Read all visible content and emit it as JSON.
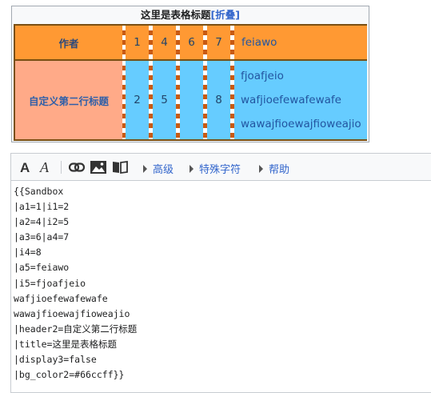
{
  "navbox": {
    "title": "这里是表格标题",
    "toggle_open": "[",
    "toggle_label": "折叠",
    "toggle_close": "]",
    "rows": [
      {
        "header": "作者",
        "cells": [
          "1",
          "4",
          "6",
          "7"
        ],
        "items": [
          "feiawo"
        ]
      },
      {
        "header": "自定义第二行标题",
        "cells": [
          "2",
          "5",
          "",
          "8"
        ],
        "items": [
          "fjoafjeio",
          "wafjioefewafewafe",
          "wawajfioewajfioweajio"
        ]
      }
    ],
    "bg_color2": "#66ccff"
  },
  "toolbar": {
    "bold_icon": "bold-A-icon",
    "italic_icon": "italic-A-icon",
    "link_icon": "link-icon",
    "image_icon": "image-icon",
    "reference_icon": "book-icon",
    "advanced": "高级",
    "special_chars": "特殊字符",
    "help": "帮助"
  },
  "editor": {
    "lines": [
      "{{Sandbox",
      "|a1=1|i1=2",
      "|a2=4|i2=5",
      "|a3=6|a4=7",
      "|i4=8",
      "|a5=feiawo",
      "|i5=fjoafjeio",
      "wafjioefewafewafe",
      "wawajfioewajfioweajio",
      "|header2=自定义第二行标题",
      "|title=这里是表格标题",
      "|display3=false",
      "|bg_color2=#66ccff}}"
    ]
  }
}
